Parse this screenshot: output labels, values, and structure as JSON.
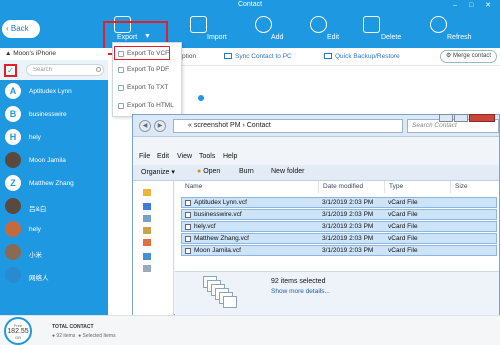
{
  "window": {
    "title": "Contact",
    "controls": "– □ ✕"
  },
  "toolbar": {
    "back": "Back",
    "export": "Export",
    "import": "Import",
    "add": "Add",
    "edit": "Edit",
    "delete": "Delete",
    "refresh": "Refresh"
  },
  "export_menu": {
    "items": [
      "Export To VCF",
      "Export To PDF",
      "Export To TXT",
      "Export To HTML"
    ],
    "active_index": 0
  },
  "subbar": {
    "partial": "ption",
    "sync": "Sync Contact to PC",
    "backup": "Quick Backup/Restore",
    "merge": "Merge contact"
  },
  "sidebar": {
    "device": "Moon's iPhone",
    "search_placeholder": "Search",
    "contacts": [
      {
        "initial": "A",
        "name": "Aptitudex Lynn"
      },
      {
        "initial": "B",
        "name": "businesswire"
      },
      {
        "initial": "H",
        "name": "hely"
      },
      {
        "initial": "",
        "name": "Moon Jamila"
      },
      {
        "initial": "Z",
        "name": "Matthew Zhang"
      },
      {
        "initial": "",
        "name": "吕&白"
      },
      {
        "initial": "",
        "name": "hely"
      },
      {
        "initial": "",
        "name": "小米"
      },
      {
        "initial": "",
        "name": "网络人"
      }
    ]
  },
  "footer": {
    "free_label": "Free",
    "free_value": "182.55",
    "free_unit": "GB",
    "total_label": "TOTAL CONTACT",
    "items": "92 items",
    "selected": "Selected Items"
  },
  "explorer": {
    "path": "« screenshot PM › Contact",
    "search_placeholder": "Search Contact",
    "menu": [
      "File",
      "Edit",
      "View",
      "Tools",
      "Help"
    ],
    "commands": [
      "Organize ▾",
      "Open",
      "Burn",
      "New folder"
    ],
    "columns": [
      "Name",
      "Date modified",
      "Type",
      "Size"
    ],
    "files": [
      {
        "name": "Aptitudex Lynn.vcf",
        "date": "3/1/2019 2:03 PM",
        "type": "vCard File"
      },
      {
        "name": "businesswire.vcf",
        "date": "3/1/2019 2:03 PM",
        "type": "vCard File"
      },
      {
        "name": "hely.vcf",
        "date": "3/1/2019 2:03 PM",
        "type": "vCard File"
      },
      {
        "name": "Matthew Zhang.vcf",
        "date": "3/1/2019 2:03 PM",
        "type": "vCard File"
      },
      {
        "name": "Moon Jamila.vcf",
        "date": "3/1/2019 2:03 PM",
        "type": "vCard File"
      }
    ],
    "selected_count": "92 items selected",
    "show_more": "Show more details..."
  },
  "colors": {
    "brand": "#1e98e0",
    "highlight": "#e3202a"
  }
}
